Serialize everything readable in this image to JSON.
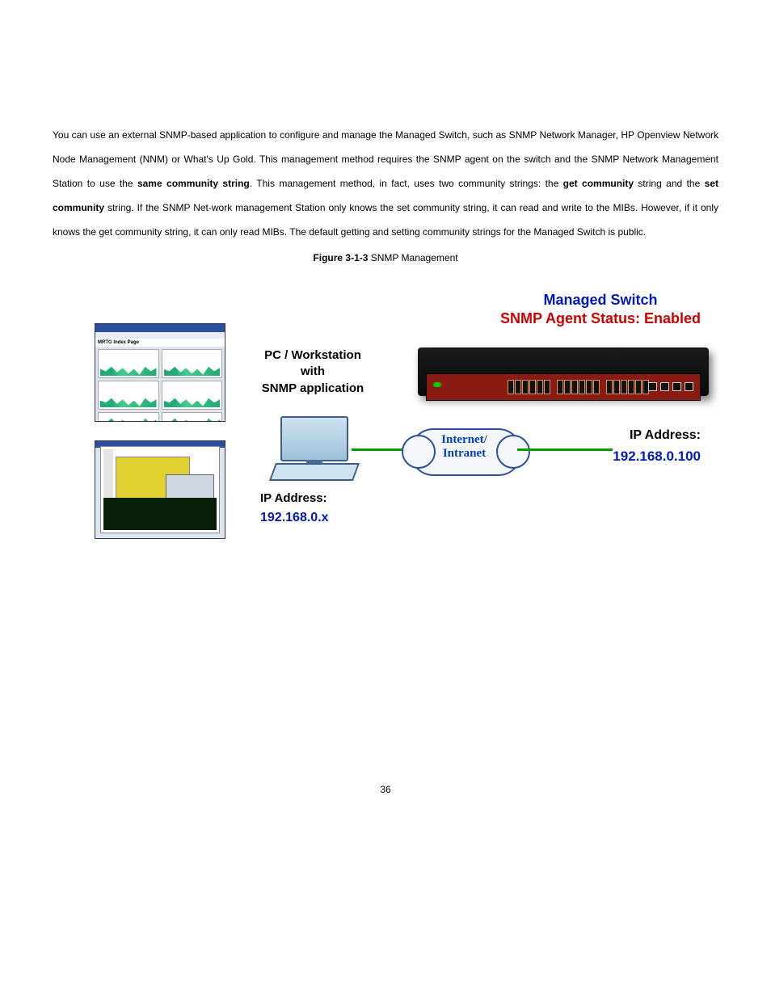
{
  "body": {
    "para1_a": "You can use an external SNMP-based application to configure and manage the Managed Switch, such as SNMP Network Manager, HP Openview Network Node Management (NNM) or What's Up Gold. This management method requires the SNMP agent on the switch and the SNMP Network Management Station to use the ",
    "bold1": "same community string",
    "para1_b": ". This management method, in fact, uses two community strings: the ",
    "bold2": "get community",
    "para1_c": " string and the ",
    "bold3": "set community",
    "para1_d": " string. If the SNMP Net-work management Station only knows the set community string, it can read and write to the MIBs. However, if it only knows the get community string, it can only read MIBs. The default getting and setting community strings for the Managed Switch is public."
  },
  "figure_caption_prefix": "Figure 3-1-3",
  "figure_caption": " SNMP Management",
  "figure": {
    "top_title_l1": "Managed Switch",
    "top_title_l2": "SNMP Agent Status: Enabled",
    "pc_label_l1": "PC / Workstation",
    "pc_label_l2": "with",
    "pc_label_l3": "SNMP application",
    "cloud_l1": "Internet/",
    "cloud_l2": "Intranet",
    "pc_ip_label": "IP Address:",
    "pc_ip_value": "192.168.0.x",
    "switch_ip_label": "IP Address:",
    "switch_ip_value": "192.168.0.100",
    "mrtg_title": "MRTG Index Page"
  },
  "page_number": "36"
}
